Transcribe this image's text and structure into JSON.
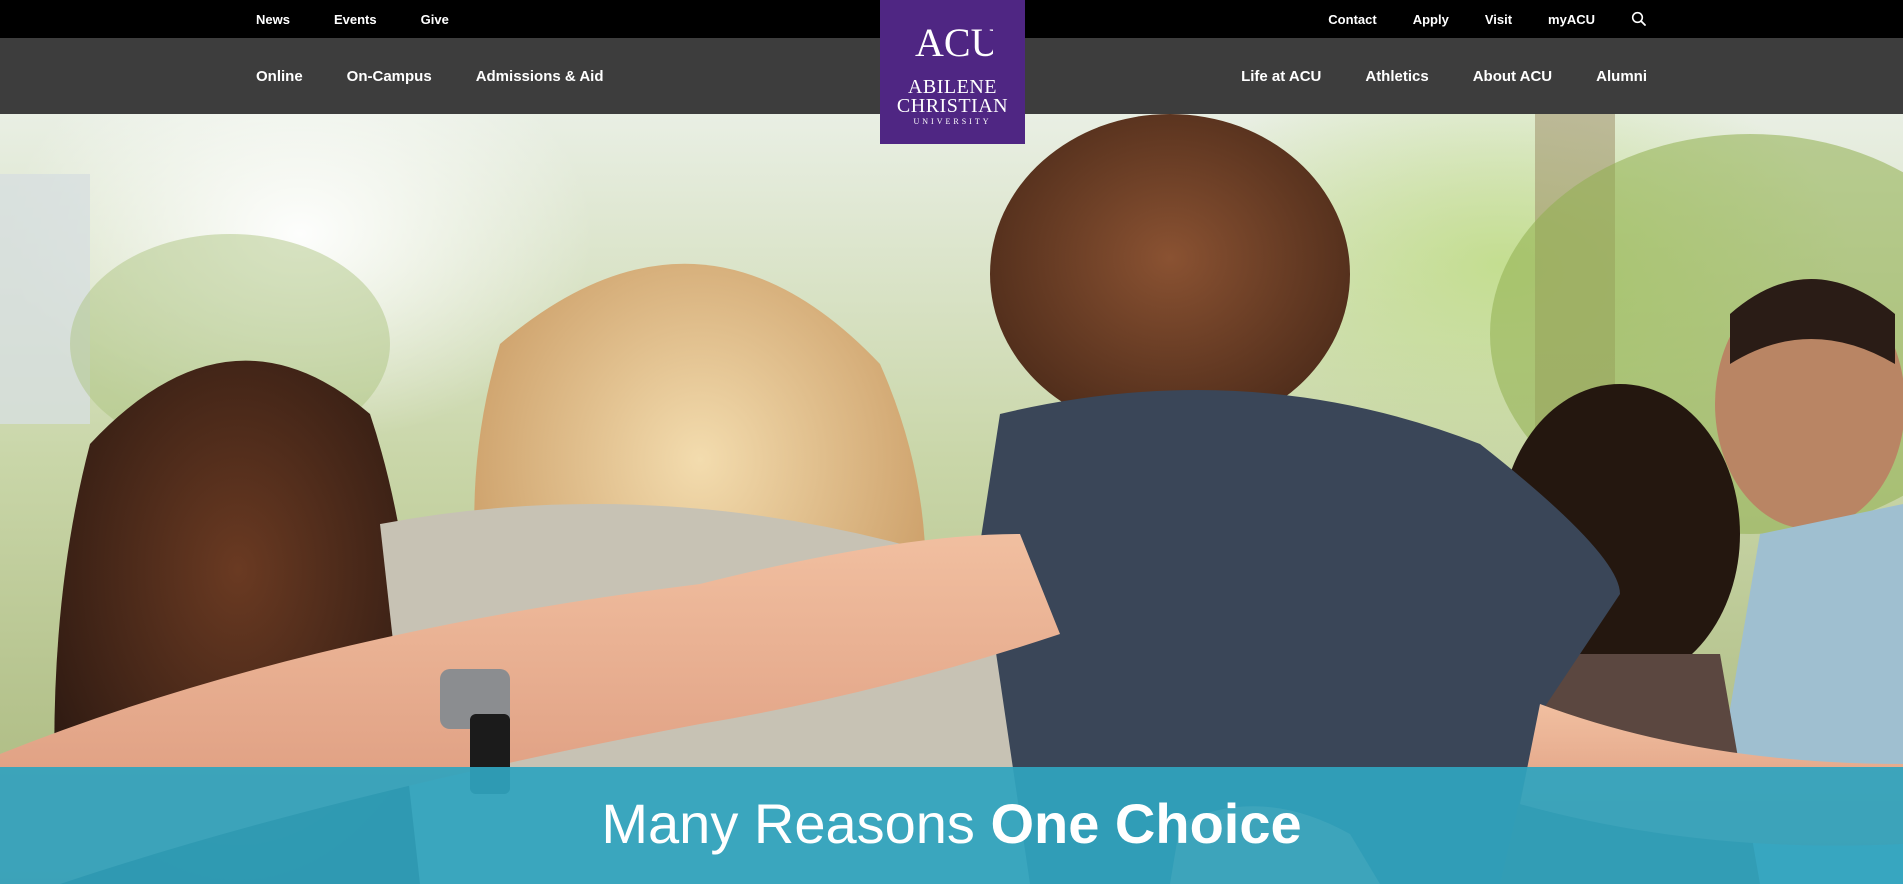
{
  "utility_nav": {
    "left": [
      "News",
      "Events",
      "Give"
    ],
    "right": [
      "Contact",
      "Apply",
      "Visit",
      "myACU"
    ],
    "search_icon": "search-icon"
  },
  "main_nav": {
    "left": [
      "Online",
      "On-Campus",
      "Admissions & Aid"
    ],
    "right": [
      "Life at ACU",
      "Athletics",
      "About ACU",
      "Alumni"
    ]
  },
  "logo": {
    "monogram": "ACU",
    "line1": "ABILENE",
    "line2": "CHRISTIAN",
    "line3": "UNIVERSITY"
  },
  "hero": {
    "tagline_light": "Many Reasons ",
    "tagline_bold": "One Choice"
  },
  "colors": {
    "utility_bg": "#000000",
    "nav_bg": "#3d3d3d",
    "brand_purple": "#4f2683",
    "tagline_band": "#2fa4be"
  }
}
